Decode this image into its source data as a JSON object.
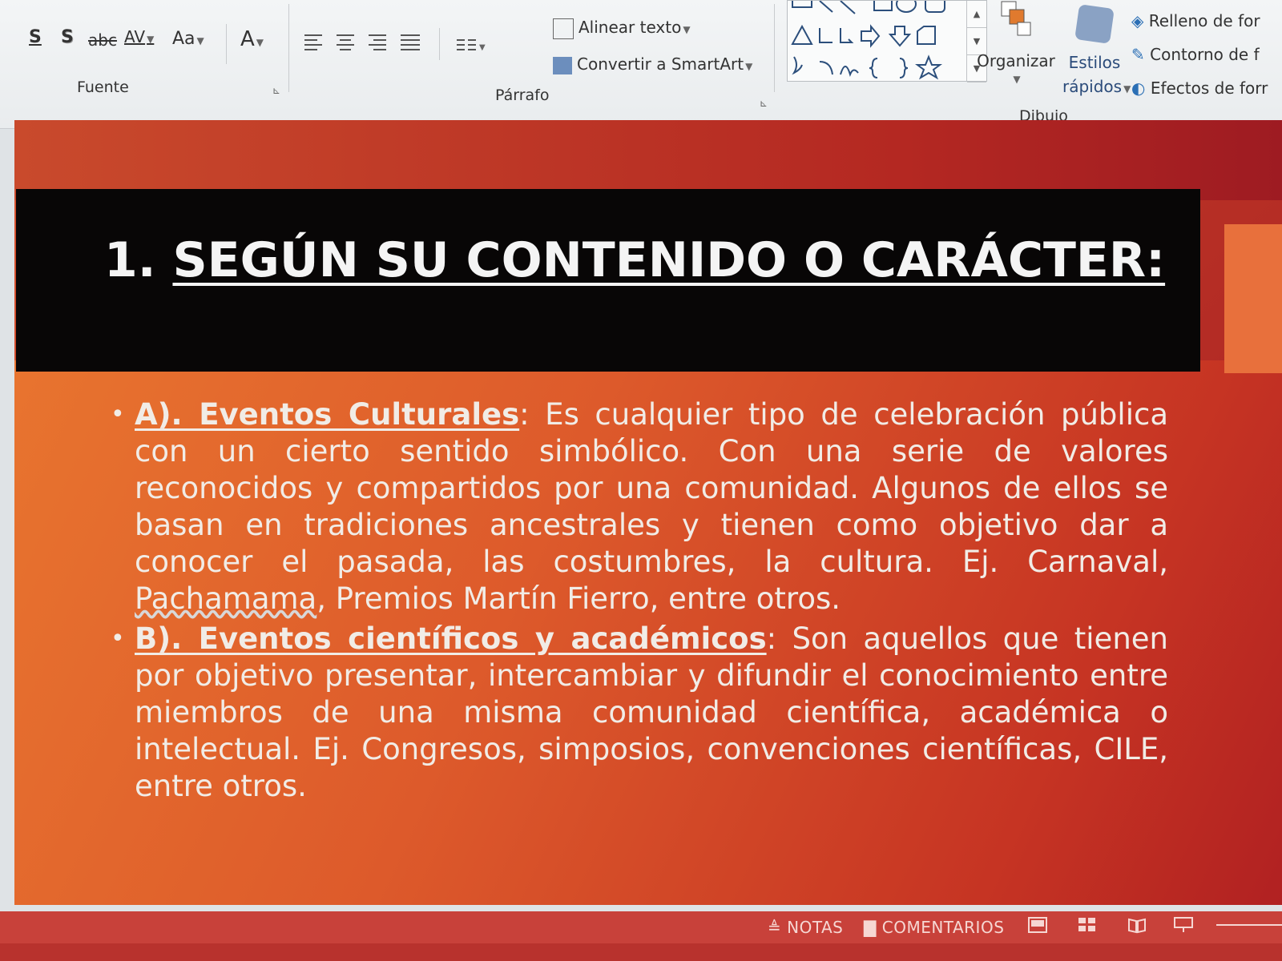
{
  "ribbon": {
    "fuente": {
      "label": "Fuente",
      "buttons": [
        "S",
        "S",
        "abc",
        "AV",
        "Aa",
        "A"
      ]
    },
    "parrafo": {
      "label": "Párrafo",
      "align_text": "Alinear texto",
      "convert_smartart": "Convertir a SmartArt"
    },
    "dibujo": {
      "label": "Dibujo",
      "organize": "Organizar",
      "quick_styles_line1": "Estilos",
      "quick_styles_line2": "rápidos",
      "fill": "Relleno de for",
      "outline": "Contorno de f",
      "effects": "Efectos de forr"
    }
  },
  "slide": {
    "title_number": "1.",
    "title_text": "SEGÚN SU CONTENIDO O CARÁCTER:",
    "bullets": [
      {
        "heading": "A). Eventos Culturales",
        "body": ": Es cualquier tipo de celebración pública con un cierto sentido simbólico.  Con una serie de valores reconocidos y compartidos por una comunidad. Algunos de ellos se basan en tradiciones ancestrales y tienen como objetivo dar a conocer el pasada, las costumbres, la cultura. Ej. Carnaval, ",
        "squiggle": "Pachamama",
        "tail": ", Premios Martín Fierro, entre otros."
      },
      {
        "heading": "B). Eventos científicos y académicos",
        "body": ": Son aquellos que tienen por objetivo presentar, intercambiar y difundir el conocimiento entre miembros de una misma comunidad científica, académica o intelectual. Ej. Congresos, simposios, convenciones científicas, CILE, entre otros.",
        "squiggle": "",
        "tail": ""
      }
    ]
  },
  "statusbar": {
    "notes": "NOTAS",
    "comments": "COMENTARIOS"
  },
  "colors": {
    "title_band": "#080606",
    "slide_red": "#c13a26",
    "slide_orange": "#e8742f",
    "status_red": "#c8413a"
  }
}
